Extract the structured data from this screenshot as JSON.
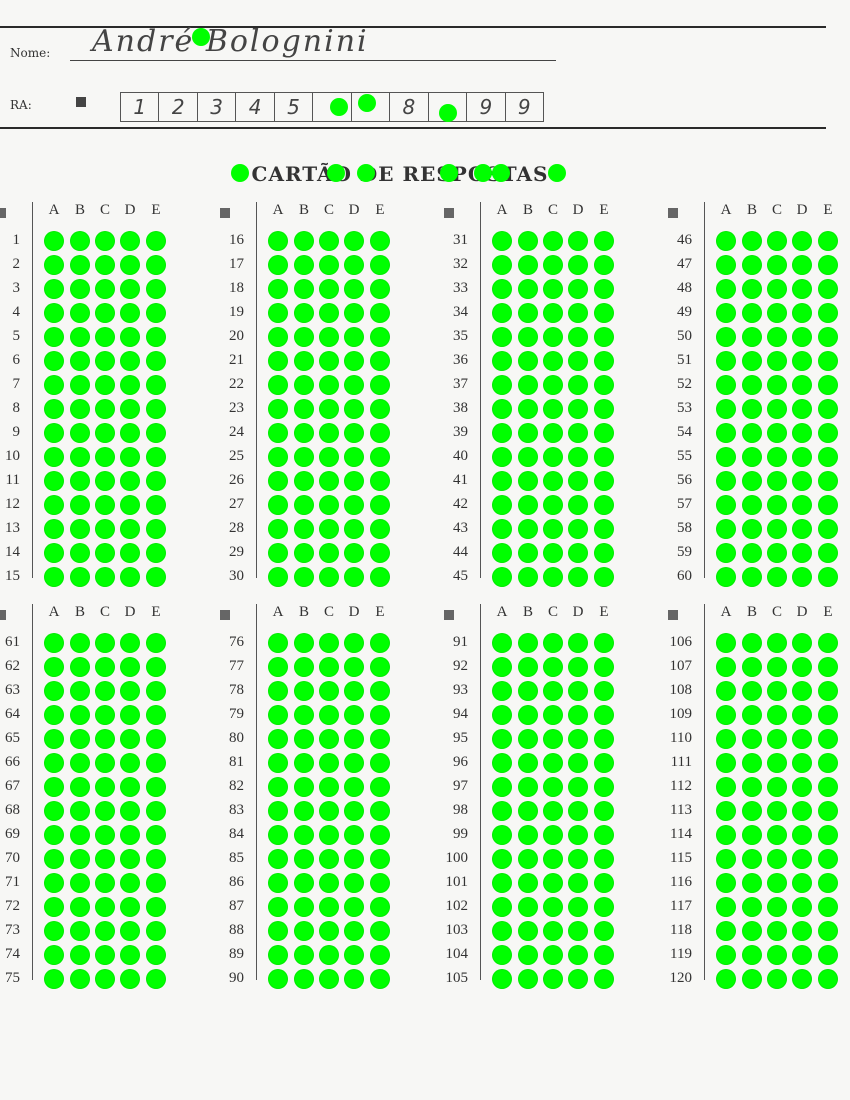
{
  "header": {
    "name_label": "Nome:",
    "name_value": "André Bolognini",
    "ra_label": "RA:",
    "ra_digits": [
      "1",
      "2",
      "3",
      "4",
      "5",
      "",
      "",
      "8",
      "",
      "9",
      "9"
    ]
  },
  "title": "CARTÃO DE RESPOSTAS",
  "options": [
    "A",
    "B",
    "C",
    "D",
    "E"
  ],
  "top_blocks": [
    {
      "start": 1,
      "end": 15
    },
    {
      "start": 16,
      "end": 30
    },
    {
      "start": 31,
      "end": 45
    },
    {
      "start": 46,
      "end": 60
    }
  ],
  "bottom_blocks": [
    {
      "start": 61,
      "end": 75
    },
    {
      "start": 76,
      "end": 90
    },
    {
      "start": 91,
      "end": 105
    },
    {
      "start": 106,
      "end": 120
    }
  ],
  "colors": {
    "mark": "#00ff00",
    "ink": "#222222",
    "paper": "#f7f7f5"
  }
}
